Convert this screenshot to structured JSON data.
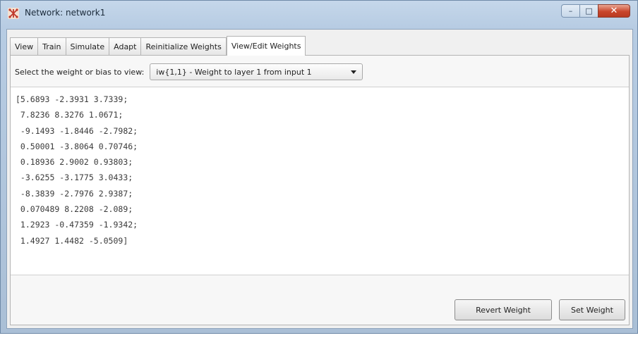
{
  "window": {
    "title": "Network: network1",
    "controls": {
      "minimize": "–",
      "maximize": "□",
      "close": "✕"
    }
  },
  "tabs": [
    {
      "label": "View"
    },
    {
      "label": "Train"
    },
    {
      "label": "Simulate"
    },
    {
      "label": "Adapt"
    },
    {
      "label": "Reinitialize Weights"
    },
    {
      "label": "View/Edit Weights",
      "active": true
    }
  ],
  "selector": {
    "label": "Select the weight or bias to view:",
    "value": "iw{1,1} - Weight to layer 1 from input 1"
  },
  "matrix": {
    "lines": [
      "[5.6893 -2.3931 3.7339;",
      " 7.8236 8.3276 1.0671;",
      " -9.1493 -1.8446 -2.7982;",
      " 0.50001 -3.8064 0.70746;",
      " 0.18936 2.9002 0.93803;",
      " -3.6255 -3.1775 3.0433;",
      " -8.3839 -2.7976 2.9387;",
      " 0.070489 8.2208 -2.089;",
      " 1.2923 -0.47359 -1.9342;",
      " 1.4927 1.4482 -5.0509]"
    ]
  },
  "buttons": {
    "revert": "Revert Weight",
    "set": "Set Weight"
  },
  "colors": {
    "title_bar": "#b7cce3",
    "close_button": "#c9452b",
    "panel_background": "#f0f0f0"
  }
}
